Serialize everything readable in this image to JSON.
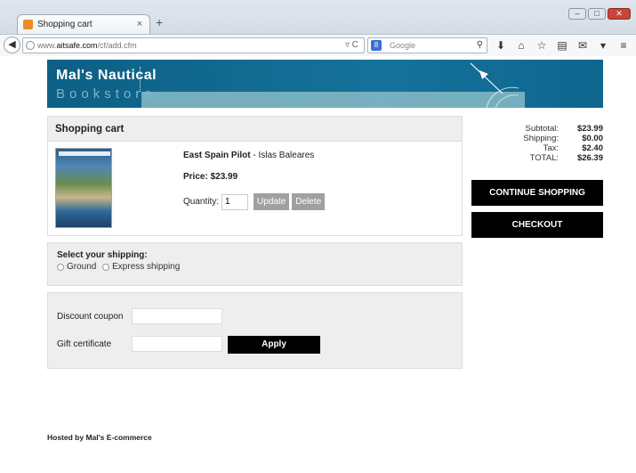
{
  "browser": {
    "tab_title": "Shopping cart",
    "tab_close": "×",
    "new_tab": "+",
    "url_prefix": "www.",
    "url_domain": "aitsafe.com",
    "url_path": "/cf/add.cfm",
    "search_placeholder": "Google"
  },
  "banner": {
    "line1": "Mal's Nautical",
    "line2": "Bookstore"
  },
  "cart": {
    "header": "Shopping cart",
    "item": {
      "title": "East Spain Pilot",
      "subtitle": " - Islas Baleares",
      "price": "Price: $23.99",
      "quantity_label": "Quantity:",
      "quantity_value": "1",
      "update_label": "Update",
      "delete_label": "Delete"
    }
  },
  "shipping": {
    "label": "Select your shipping:",
    "options": [
      "Ground",
      "Express shipping"
    ]
  },
  "discount": {
    "coupon_label": "Discount coupon",
    "gift_label": "Gift certificate",
    "apply_label": "Apply"
  },
  "totals": {
    "subtotal_label": "Subtotal:",
    "subtotal": "$23.99",
    "shipping_label": "Shipping:",
    "shipping": "$0.00",
    "tax_label": "Tax:",
    "tax": "$2.40",
    "total_label": "TOTAL:",
    "total": "$26.39"
  },
  "actions": {
    "continue_label": "CONTINUE SHOPPING",
    "checkout_label": "CHECKOUT"
  },
  "footer": {
    "hosted": "Hosted by Mal's E-commerce"
  }
}
